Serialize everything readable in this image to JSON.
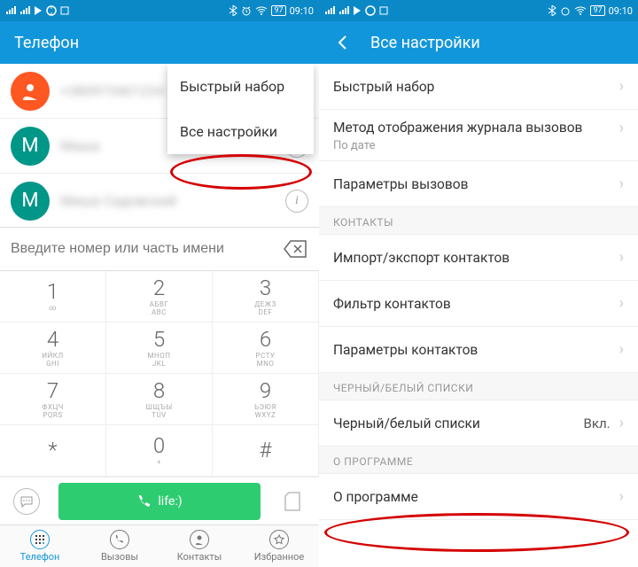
{
  "status": {
    "time": "09:10",
    "battery": "97"
  },
  "left": {
    "title": "Телефон",
    "popup": [
      "Быстрый набор",
      "Все настройки"
    ],
    "calls": [
      {
        "avatar": "person",
        "color": "av-orange",
        "name": "+380973461234"
      },
      {
        "avatar": "M",
        "color": "av-teal",
        "name": "Маша"
      },
      {
        "avatar": "M",
        "color": "av-teal",
        "name": "Миша Садовский"
      }
    ],
    "search_placeholder": "Введите номер или часть имени",
    "keys": [
      {
        "n": "1",
        "s": "∞"
      },
      {
        "n": "2",
        "s": "АБВГ\nABC"
      },
      {
        "n": "3",
        "s": "ДЕЖЗ\nDEF"
      },
      {
        "n": "4",
        "s": "ИЙКЛ\nGHI"
      },
      {
        "n": "5",
        "s": "МНОП\nJKL"
      },
      {
        "n": "6",
        "s": "РСТУ\nMNO"
      },
      {
        "n": "7",
        "s": "ФХЦЧ\nPQRS"
      },
      {
        "n": "8",
        "s": "ШЩЪЫ\nTUV"
      },
      {
        "n": "9",
        "s": "ЬЭЮЯ\nWXYZ"
      },
      {
        "n": "*",
        "s": ""
      },
      {
        "n": "0",
        "s": "+"
      },
      {
        "n": "#",
        "s": ""
      }
    ],
    "call_button": "life:)",
    "nav": [
      "Телефон",
      "Вызовы",
      "Контакты",
      "Избранное"
    ]
  },
  "right": {
    "title": "Все настройки",
    "rows": [
      {
        "label": "Быстрый набор",
        "type": "item"
      },
      {
        "label": "Метод отображения журнала вызовов",
        "sub": "По дате",
        "type": "tall"
      },
      {
        "label": "Параметры вызовов",
        "type": "item"
      },
      {
        "label": "КОНТАКТЫ",
        "type": "header"
      },
      {
        "label": "Импорт/экспорт контактов",
        "type": "item"
      },
      {
        "label": "Фильтр контактов",
        "type": "item"
      },
      {
        "label": "Параметры контактов",
        "type": "item"
      },
      {
        "label": "ЧЕРНЫЙ/БЕЛЫЙ СПИСКИ",
        "type": "header"
      },
      {
        "label": "Черный/белый списки",
        "value": "Вкл.",
        "type": "item"
      },
      {
        "label": "О ПРОГРАММЕ",
        "type": "header"
      },
      {
        "label": "О программе",
        "type": "item"
      }
    ]
  }
}
